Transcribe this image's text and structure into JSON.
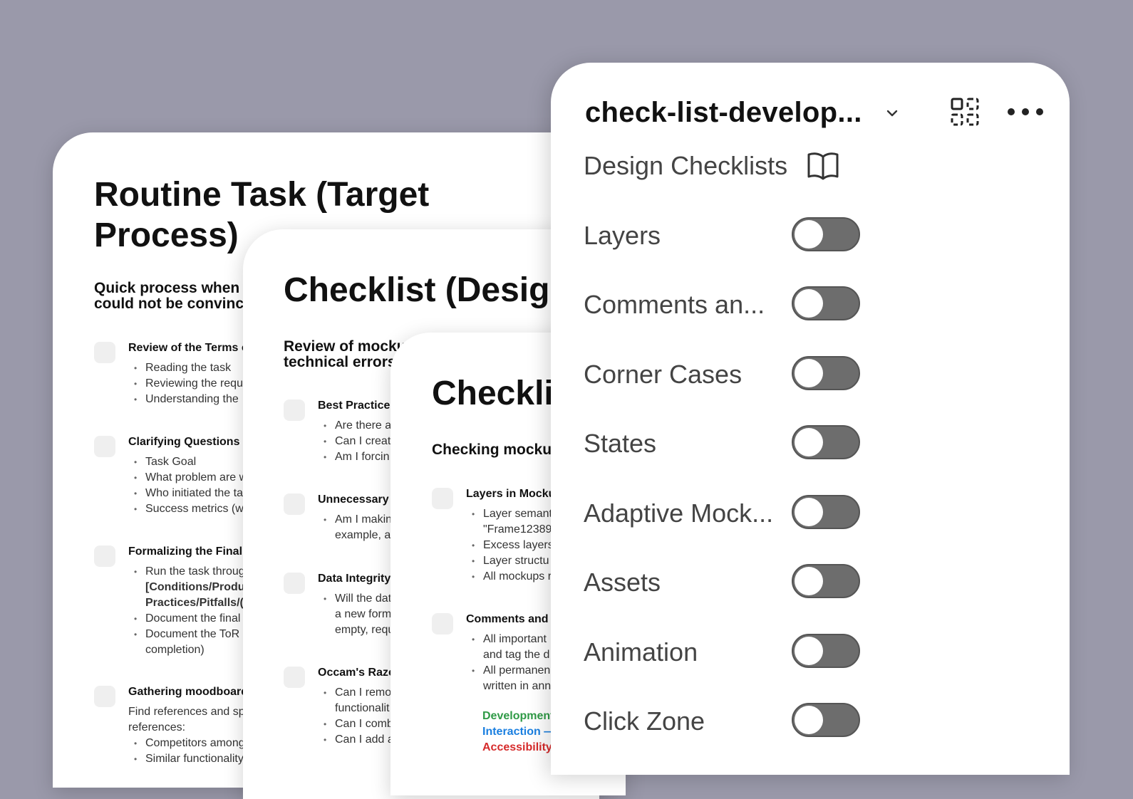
{
  "card1": {
    "title_line1": "Routine Task (Target",
    "title_line2": "Process)",
    "subtitle_line1": "Quick process when t",
    "subtitle_line2": "could not be convinc",
    "items": [
      {
        "title": "Review of the Terms o",
        "bullets": [
          "Reading the task",
          "Reviewing the requ",
          "Understanding the"
        ]
      },
      {
        "title": "Clarifying Questions",
        "bullets": [
          "Task Goal",
          "What problem are w",
          "Who initiated the ta",
          "Success metrics (w"
        ]
      },
      {
        "title": "Formalizing the Final",
        "bullets": [
          "Run the task throug",
          "[Conditions/Produ",
          "Practices/Pitfalls/(",
          "Document the final",
          "Document the ToR",
          "completion)"
        ]
      },
      {
        "title": "Gathering moodboard",
        "text1": "Find references and sp",
        "text2": "references:",
        "bullets": [
          "Competitors among",
          "Similar functionality"
        ]
      }
    ]
  },
  "card2": {
    "title": "Checklist (Design",
    "subtitle_line1": "Review of mocku",
    "subtitle_line2": "technical errors",
    "items": [
      {
        "title": "Best Practice",
        "bullets": [
          "Are there a",
          "Can I creat",
          "Am I forcin"
        ]
      },
      {
        "title": "Unnecessary",
        "bullets": [
          "Am I makin",
          "example, a"
        ]
      },
      {
        "title": "Data Integrity",
        "bullets": [
          "Will the dat",
          "a new form",
          "empty, requ"
        ]
      },
      {
        "title": "Occam's Razo",
        "bullets": [
          "Can I remo",
          "functionalit",
          "Can I comb",
          "Can I add a"
        ]
      }
    ]
  },
  "card3": {
    "title": "Checklis",
    "subtitle": "Checking mocku",
    "items": [
      {
        "title": "Layers in Mocku",
        "bullets": [
          "Layer semant",
          "\"Frame12389",
          "Excess layers",
          "Layer structu",
          "All mockups r"
        ]
      },
      {
        "title": "Comments and",
        "bullets": [
          "All important",
          "and tag the d",
          "All permanen",
          "written in ann"
        ]
      }
    ],
    "legend": [
      {
        "label": "Development",
        "color": "#2f9a46"
      },
      {
        "label": "Interaction —",
        "color": "#1a7fe0"
      },
      {
        "label": "Accessibility",
        "color": "#d62b2b"
      }
    ]
  },
  "panel": {
    "title": "check-list-develop...",
    "subheading": "Design Checklists",
    "icons": {
      "dropdown": "chevron-down-icon",
      "qr": "qr-code-icon",
      "menu": "more-horizontal-icon",
      "book": "book-open-icon"
    },
    "toggles": [
      {
        "label": "Layers",
        "on": false
      },
      {
        "label": "Comments an...",
        "on": false
      },
      {
        "label": "Corner Cases",
        "on": false
      },
      {
        "label": "States",
        "on": false
      },
      {
        "label": "Adaptive Mock...",
        "on": false
      },
      {
        "label": "Assets",
        "on": false
      },
      {
        "label": "Animation",
        "on": false
      },
      {
        "label": "Click Zone",
        "on": false
      }
    ]
  }
}
